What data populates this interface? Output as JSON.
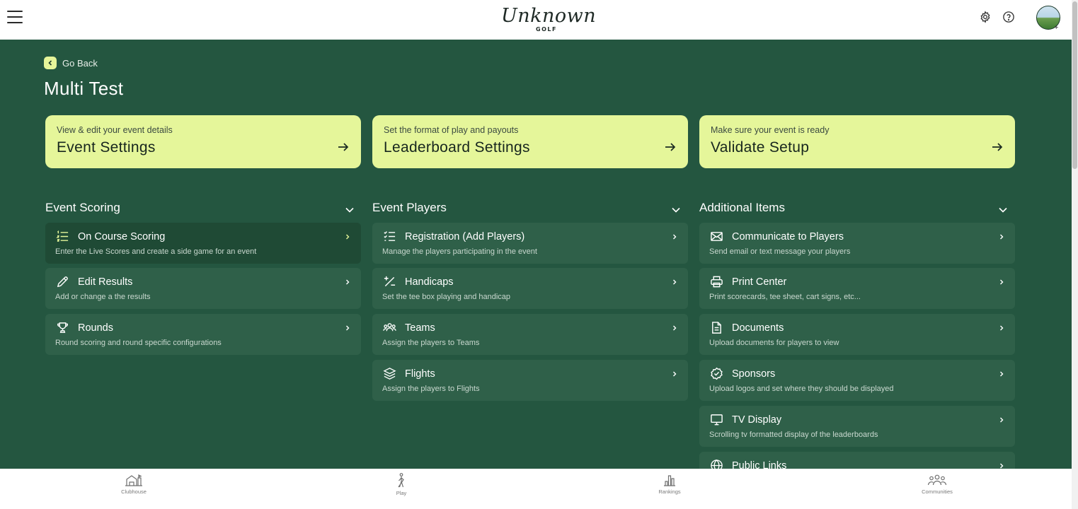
{
  "header": {
    "logo_script": "Unknown",
    "logo_sub": "GOLF"
  },
  "nav": {
    "go_back": "Go Back"
  },
  "page": {
    "title": "Multi Test"
  },
  "top_cards": [
    {
      "subtitle": "View & edit your event details",
      "title": "Event Settings"
    },
    {
      "subtitle": "Set the format of play and payouts",
      "title": "Leaderboard Settings"
    },
    {
      "subtitle": "Make sure your event is ready",
      "title": "Validate Setup"
    }
  ],
  "sections": [
    {
      "title": "Event Scoring",
      "items": [
        {
          "icon": "list-ordered-icon",
          "title": "On Course Scoring",
          "desc": "Enter the Live Scores and create a side game for an event"
        },
        {
          "icon": "pencil-icon",
          "title": "Edit Results",
          "desc": "Add or change a the results"
        },
        {
          "icon": "trophy-icon",
          "title": "Rounds",
          "desc": "Round scoring and round specific configurations"
        }
      ]
    },
    {
      "title": "Event Players",
      "items": [
        {
          "icon": "checklist-icon",
          "title": "Registration (Add Players)",
          "desc": "Manage the players participating in the event"
        },
        {
          "icon": "plus-minus-icon",
          "title": "Handicaps",
          "desc": "Set the tee box playing and handicap"
        },
        {
          "icon": "users-icon",
          "title": "Teams",
          "desc": "Assign the players to Teams"
        },
        {
          "icon": "layers-icon",
          "title": "Flights",
          "desc": "Assign the players to Flights"
        }
      ]
    },
    {
      "title": "Additional Items",
      "items": [
        {
          "icon": "mail-icon",
          "title": "Communicate to Players",
          "desc": "Send email or text message your players"
        },
        {
          "icon": "printer-icon",
          "title": "Print Center",
          "desc": "Print scorecards, tee sheet, cart signs, etc..."
        },
        {
          "icon": "document-icon",
          "title": "Documents",
          "desc": "Upload documents for players to view"
        },
        {
          "icon": "badge-check-icon",
          "title": "Sponsors",
          "desc": "Upload logos and set where they should be displayed"
        },
        {
          "icon": "monitor-icon",
          "title": "TV Display",
          "desc": "Scrolling tv formatted display of the leaderboards"
        },
        {
          "icon": "globe-icon",
          "title": "Public Links",
          "desc": ""
        }
      ]
    }
  ],
  "bottom_nav": [
    {
      "icon": "clubhouse-icon",
      "label": "Clubhouse"
    },
    {
      "icon": "golfer-icon",
      "label": "Play"
    },
    {
      "icon": "rankings-icon",
      "label": "Rankings"
    },
    {
      "icon": "communities-icon",
      "label": "Communities"
    }
  ],
  "colors": {
    "background": "#245640",
    "card_accent": "#e5f69a",
    "item_bg": "#2f6049",
    "item_active_bg": "#1f4a35"
  }
}
